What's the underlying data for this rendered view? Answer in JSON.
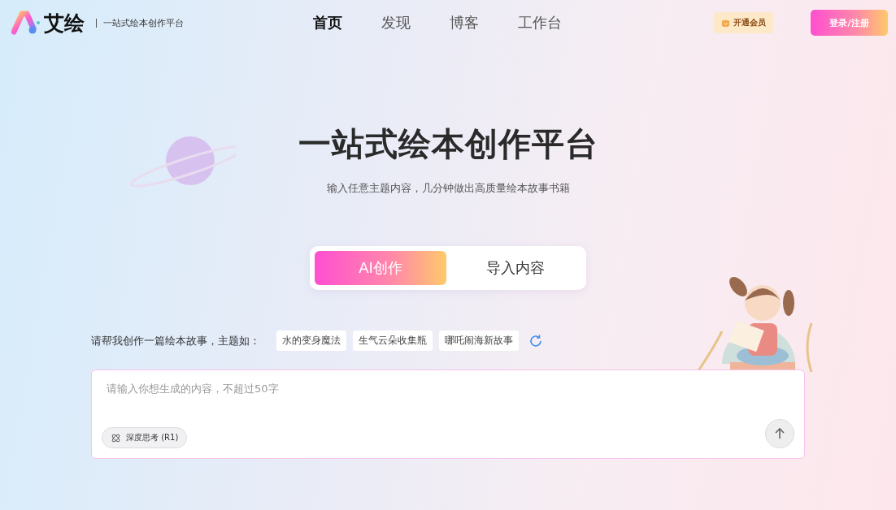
{
  "header": {
    "logo": "艾绘",
    "tagline": "一站式绘本创作平台",
    "nav": [
      {
        "label": "首页",
        "selected": true
      },
      {
        "label": "发现",
        "selected": false
      },
      {
        "label": "博客",
        "selected": false
      },
      {
        "label": "工作台",
        "selected": false
      }
    ],
    "vip_button": "开通会员",
    "login_button": "登录/注册"
  },
  "hero": {
    "title": "一站式绘本创作平台",
    "subtitle": "输入任意主题内容，几分钟做出高质量绘本故事书籍"
  },
  "mode_tabs": [
    {
      "label": "AI创作",
      "selected": true
    },
    {
      "label": "导入内容",
      "selected": false
    }
  ],
  "suggestions": {
    "label": "请帮我创作一篇绘本故事，主题如：",
    "topics": [
      "水的变身魔法",
      "生气云朵收集瓶",
      "哪吒闹海新故事"
    ]
  },
  "prompt": {
    "placeholder": "请输入你想生成的内容，不超过50字",
    "deep_think": {
      "label": "深度思考 (R1)",
      "on": false
    }
  }
}
